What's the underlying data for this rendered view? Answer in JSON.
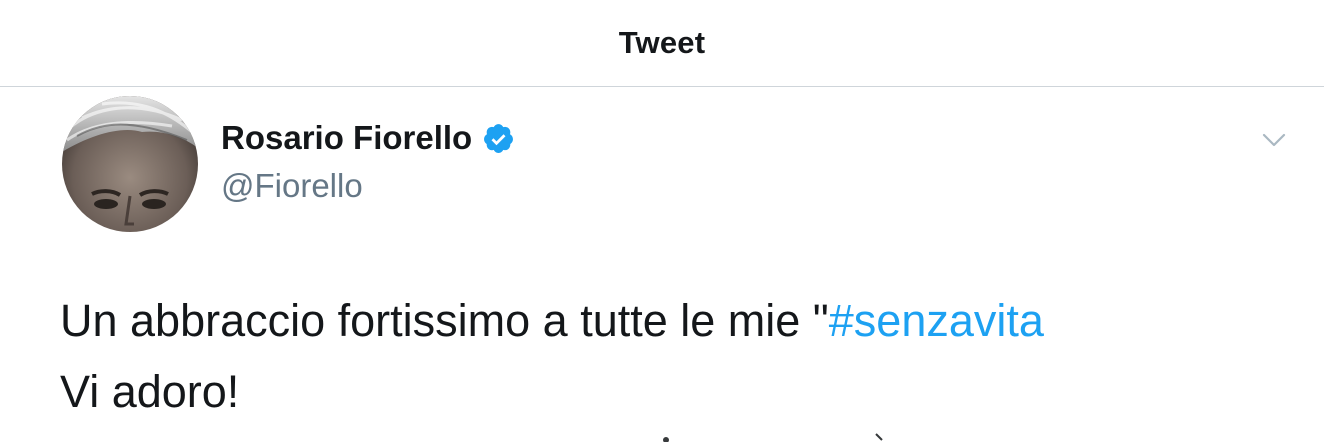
{
  "header": {
    "title": "Tweet"
  },
  "tweet": {
    "author": {
      "name": "Rosario Fiorello",
      "handle": "@Fiorello",
      "verified": true,
      "avatar_icon": "profile-photo"
    },
    "menu_icon": "chevron-down-icon",
    "text": {
      "line1_text": "Un abbraccio fortissimo a tutte le mie \"",
      "hashtag": "#senzavita",
      "line2_text": "Vi adoro!"
    }
  },
  "colors": {
    "text_primary": "#14171a",
    "text_secondary": "#657786",
    "accent": "#1da1f2",
    "divider": "#cfd5da"
  }
}
